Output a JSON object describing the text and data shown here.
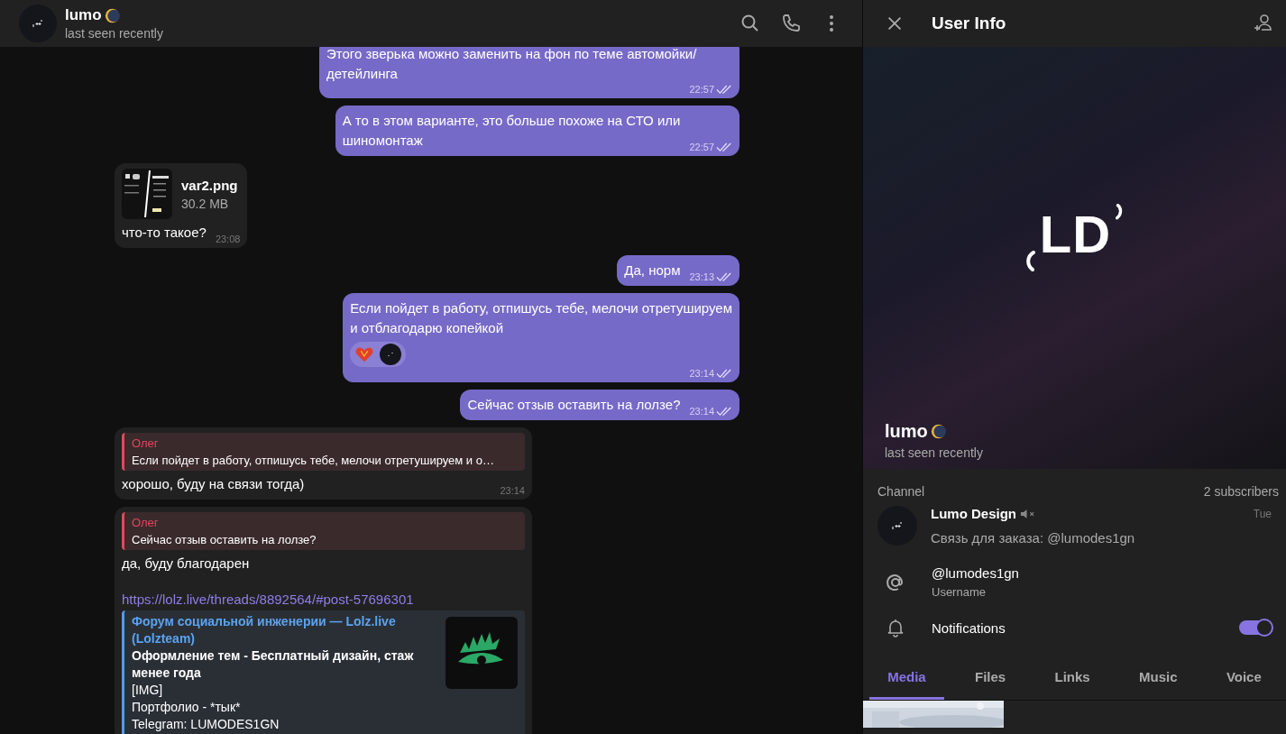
{
  "chat_header": {
    "name": "lumo",
    "status": "last seen recently"
  },
  "messages": [
    {
      "kind": "text",
      "outgoing": true,
      "text": "Этого зверька можно заменить на фон по теме автомойки/\nдетейлинга",
      "time": "22:57",
      "read": true
    },
    {
      "kind": "text",
      "outgoing": true,
      "text": "А то в этом варианте, это больше похоже на СТО или\nшиномонтаж",
      "time": "22:57",
      "read": true
    },
    {
      "kind": "file",
      "outgoing": false,
      "file_name": "var2.png",
      "file_size": "30.2 MB",
      "text": "что-то такое?",
      "time": "23:08"
    },
    {
      "kind": "text",
      "outgoing": true,
      "text": "Да, норм",
      "time": "23:13",
      "read": true
    },
    {
      "kind": "text",
      "outgoing": true,
      "text": "Если пойдет в работу, отпишусь тебе, мелочи отретушируем\nи отблагодарю копейкой",
      "time": "23:14",
      "read": true,
      "reacted": true
    },
    {
      "kind": "text",
      "outgoing": true,
      "text": "Сейчас отзыв оставить на лолзе?",
      "time": "23:14",
      "read": true
    },
    {
      "kind": "reply",
      "outgoing": false,
      "quote_author": "Олег",
      "quote_text": "Если пойдет в работу, отпишусь тебе, мелочи отретушируем и о…",
      "text": "хорошо, буду на связи тогда)",
      "time": "23:14"
    },
    {
      "kind": "link",
      "outgoing": false,
      "quote_author": "Олег",
      "quote_text": "Сейчас отзыв оставить на лолзе?",
      "text": "да, буду благодарен",
      "link": "https://lolz.live/threads/8892564/#post-57696301",
      "preview": {
        "site": "Форум социальной инженерии — Lolz.live (Lolzteam)",
        "title": "Оформление тем - Бесплатный дизайн, стаж менее года",
        "lines": [
          "[IMG]",
          "Портфолио - *тык*",
          "Telegram: LUMODES1GN"
        ]
      }
    }
  ],
  "user_info": {
    "title": "User Info",
    "logo_text": "LD",
    "name": "lumo",
    "status": "last seen recently",
    "channel": {
      "label": "Channel",
      "subscribers": "2 subscribers",
      "name": "Lumo Design",
      "muted": true,
      "date": "Tue",
      "description": "Связь для заказа: @lumodes1gn"
    },
    "username": {
      "value": "@lumodes1gn",
      "label": "Username"
    },
    "notifications": {
      "label": "Notifications",
      "on": true
    },
    "tabs": [
      {
        "label": "Media",
        "selected": true
      },
      {
        "label": "Files",
        "selected": false
      },
      {
        "label": "Links",
        "selected": false
      },
      {
        "label": "Music",
        "selected": false
      },
      {
        "label": "Voice",
        "selected": false
      }
    ]
  }
}
